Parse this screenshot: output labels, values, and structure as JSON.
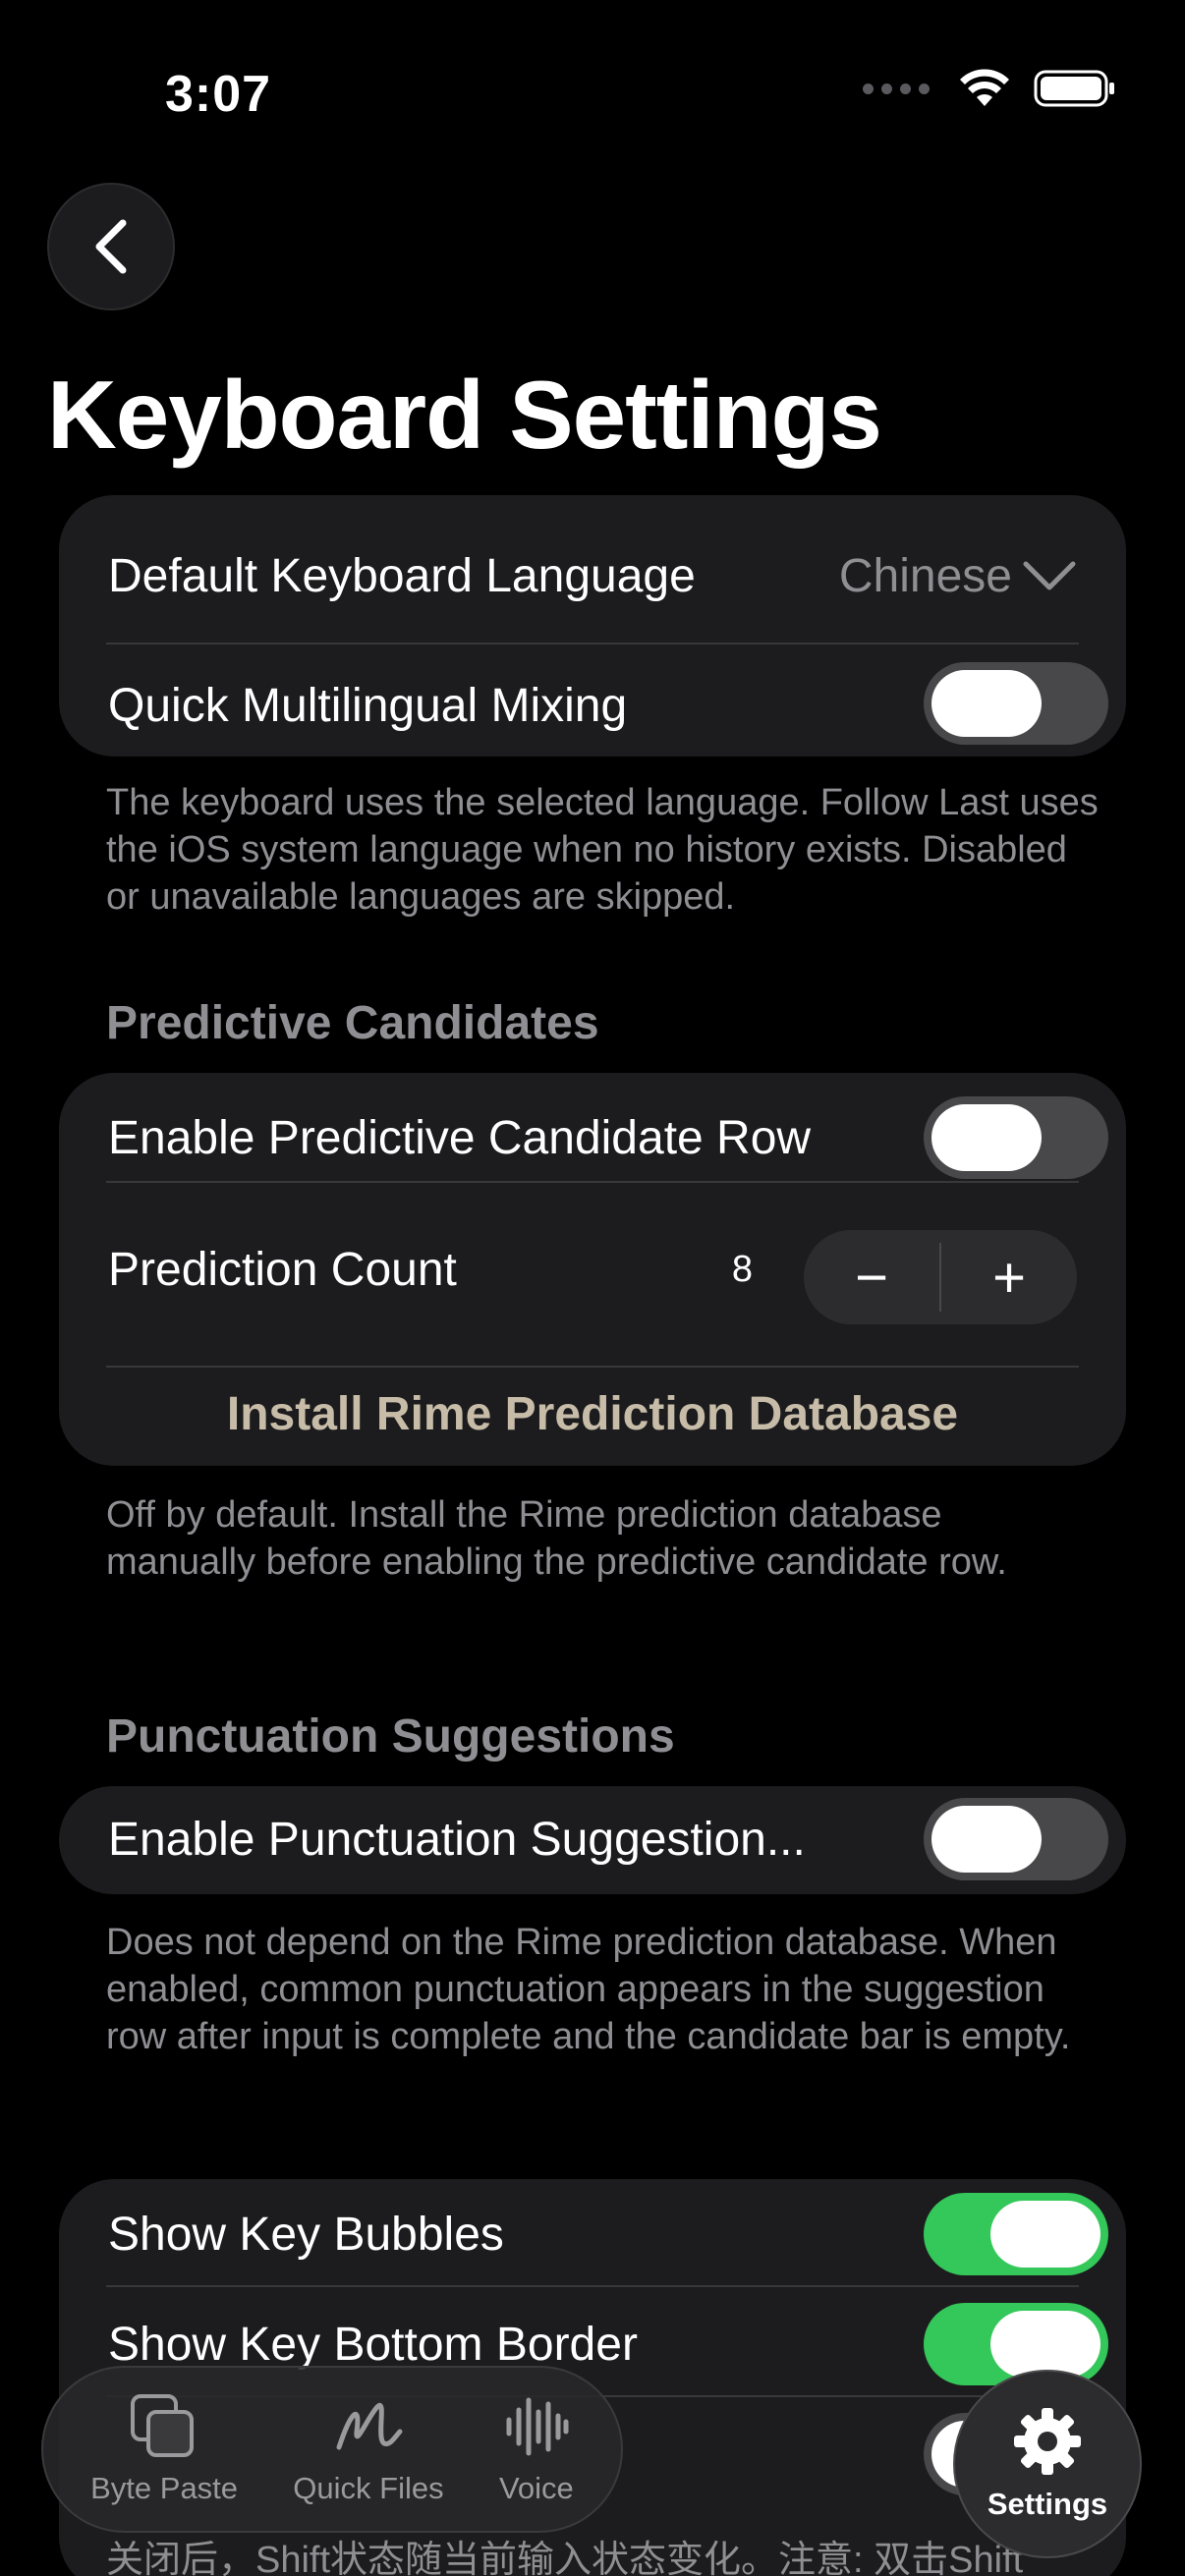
{
  "status_bar": {
    "time": "3:07"
  },
  "page": {
    "title": "Keyboard Settings"
  },
  "language_section": {
    "default_language_label": "Default Keyboard Language",
    "default_language_value": "Chinese",
    "quick_mixing_label": "Quick Multilingual Mixing",
    "quick_mixing_on": false,
    "footnote": "The keyboard uses the selected language. Follow Last uses the iOS system language when no history exists. Disabled or unavailable languages are skipped."
  },
  "predictive_section": {
    "header": "Predictive Candidates",
    "enable_row_label": "Enable Predictive Candidate Row",
    "enable_row_on": false,
    "prediction_count_label": "Prediction Count",
    "prediction_count_value": "8",
    "decrement_symbol": "−",
    "increment_symbol": "+",
    "install_button": "Install Rime Prediction Database",
    "footnote": "Off by default. Install the Rime prediction database manually before enabling the predictive candidate row."
  },
  "punctuation_section": {
    "header": "Punctuation Suggestions",
    "enable_label": "Enable Punctuation Suggestion...",
    "enable_on": false,
    "footnote": "Does not depend on the Rime prediction database. When enabled, common punctuation appears in the suggestion row after input is complete and the candidate bar is empty."
  },
  "display_section": {
    "key_bubbles_label": "Show Key Bubbles",
    "key_bubbles_on": true,
    "key_bottom_border_label": "Show Key Bottom Border",
    "key_bottom_border_on": true,
    "partial_note": "关闭后，Shift状态随当前输入状态变化。注意: 双击Shift"
  },
  "tab_bar": {
    "items": [
      {
        "label": "Byte Paste",
        "icon": "copy-icon"
      },
      {
        "label": "Quick Files",
        "icon": "scribble-icon"
      },
      {
        "label": "Voice",
        "icon": "waveform-icon"
      }
    ],
    "settings": {
      "label": "Settings",
      "icon": "gear-icon"
    }
  },
  "colors": {
    "background": "#000000",
    "card": "#1c1c1e",
    "secondary_text": "#8e8e93",
    "toggle_on": "#34c759",
    "toggle_off": "#48484a",
    "install_text": "#c7bca8"
  }
}
